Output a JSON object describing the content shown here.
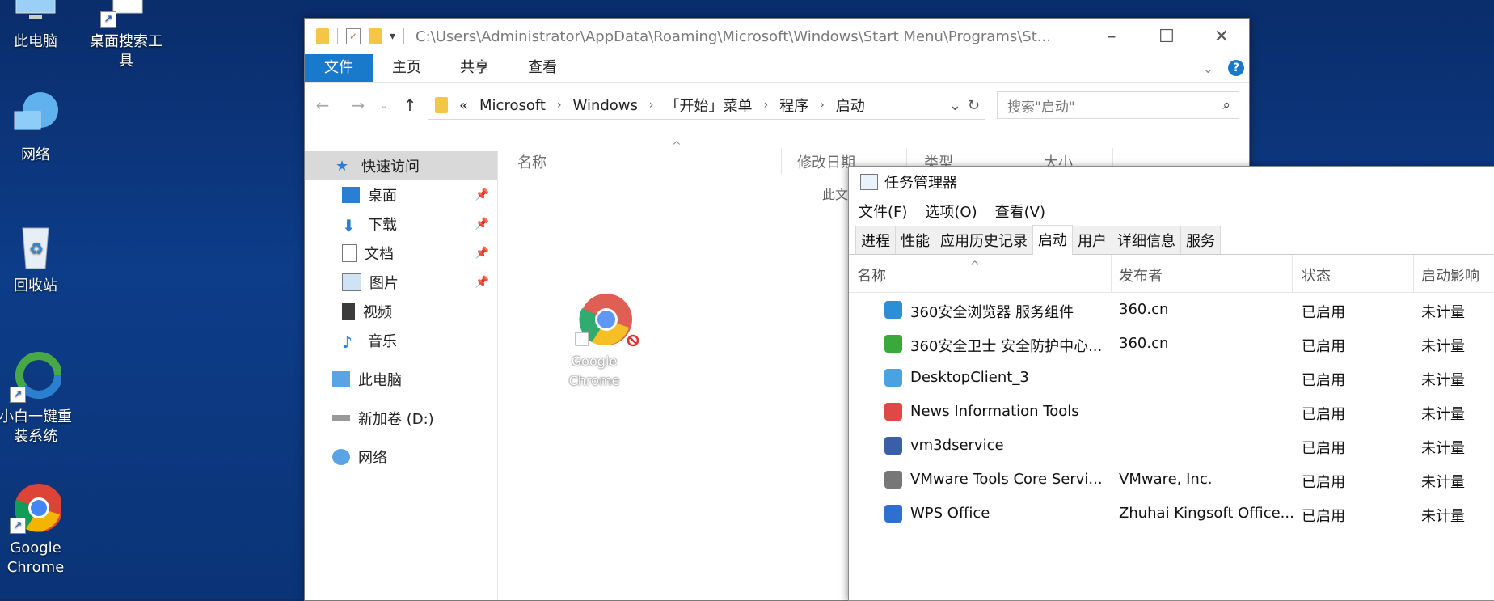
{
  "desktop": {
    "icons": [
      {
        "label": "此电脑"
      },
      {
        "label": "桌面搜索工具"
      },
      {
        "label": "网络"
      },
      {
        "label": "回收站"
      },
      {
        "label": "小白一键重装系统"
      },
      {
        "label": "Google Chrome"
      }
    ]
  },
  "explorer": {
    "title_path": "C:\\Users\\Administrator\\AppData\\Roaming\\Microsoft\\Windows\\Start Menu\\Programs\\St...",
    "ribbon_tabs": [
      "文件",
      "主页",
      "共享",
      "查看"
    ],
    "address": {
      "prefix": "«",
      "segments": [
        "Microsoft",
        "Windows",
        "「开始」菜单",
        "程序",
        "启动"
      ]
    },
    "search_placeholder": "搜索\"启动\"",
    "nav": {
      "quick_access": "快速访问",
      "items": [
        "桌面",
        "下载",
        "文档",
        "图片",
        "视频",
        "音乐"
      ],
      "this_pc": "此电脑",
      "drive": "新加卷 (D:)",
      "network": "网络"
    },
    "columns": [
      "名称",
      "修改日期",
      "类型",
      "大小"
    ],
    "empty_note": "此文",
    "dragged_item": "Google Chrome"
  },
  "taskmgr": {
    "title": "任务管理器",
    "menu": [
      "文件(F)",
      "选项(O)",
      "查看(V)"
    ],
    "tabs": [
      "进程",
      "性能",
      "应用历史记录",
      "启动",
      "用户",
      "详细信息",
      "服务"
    ],
    "active_tab": "启动",
    "columns": [
      "名称",
      "发布者",
      "状态",
      "启动影响"
    ],
    "rows": [
      {
        "name": "360安全浏览器 服务组件",
        "publisher": "360.cn",
        "status": "已启用",
        "impact": "未计量",
        "icon_color": "#2b8fd8"
      },
      {
        "name": "360安全卫士 安全防护中心...",
        "publisher": "360.cn",
        "status": "已启用",
        "impact": "未计量",
        "icon_color": "#3aa83a"
      },
      {
        "name": "DesktopClient_3",
        "publisher": "",
        "status": "已启用",
        "impact": "未计量",
        "icon_color": "#4aa3df"
      },
      {
        "name": "News Information Tools",
        "publisher": "",
        "status": "已启用",
        "impact": "未计量",
        "icon_color": "#e04848"
      },
      {
        "name": "vm3dservice",
        "publisher": "",
        "status": "已启用",
        "impact": "未计量",
        "icon_color": "#3a5ea8"
      },
      {
        "name": "VMware Tools Core Servi...",
        "publisher": "VMware, Inc.",
        "status": "已启用",
        "impact": "未计量",
        "icon_color": "#777777"
      },
      {
        "name": "WPS Office",
        "publisher": "Zhuhai Kingsoft Office...",
        "status": "已启用",
        "impact": "未计量",
        "icon_color": "#2f6fd0"
      }
    ]
  }
}
